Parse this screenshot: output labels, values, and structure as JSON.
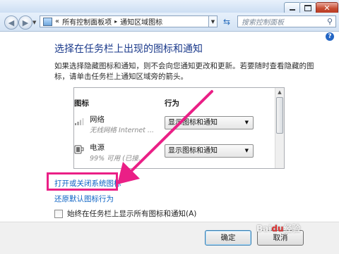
{
  "window": {
    "controls": {
      "minimize": "minimize-icon",
      "maximize": "maximize-icon",
      "close": "close-icon"
    }
  },
  "addressbar": {
    "separator": "«",
    "path": [
      "所有控制面板项",
      "通知区域图标"
    ],
    "path_separator": "▸",
    "search_placeholder": "搜索控制面板"
  },
  "page": {
    "heading": "选择在任务栏上出现的图标和通知",
    "description": "如果选择隐藏图标和通知，则不会向您通知更改和更新。若要随时查看隐藏的图标，请单击任务栏上通知区域旁的箭头。",
    "columns": {
      "icon": "图标",
      "behavior": "行为"
    },
    "rows": [
      {
        "name": "网络",
        "subtitle": "无线网络 Internet ...",
        "behavior": "显示图标和通知",
        "icon": "network-icon"
      },
      {
        "name": "电源",
        "subtitle": "99% 可用 (已接...",
        "behavior": "显示图标和通知",
        "icon": "power-icon"
      }
    ],
    "links": {
      "system_icons": "打开或关闭系统图标",
      "restore_defaults": "还原默认图标行为"
    },
    "always_show_label": "始终在任务栏上显示所有图标和通知(A)",
    "always_show_checked": false
  },
  "footer": {
    "ok": "确定",
    "cancel": "取消"
  },
  "annotation": {
    "color": "#ea1f86"
  },
  "watermark": "Baidu经验"
}
